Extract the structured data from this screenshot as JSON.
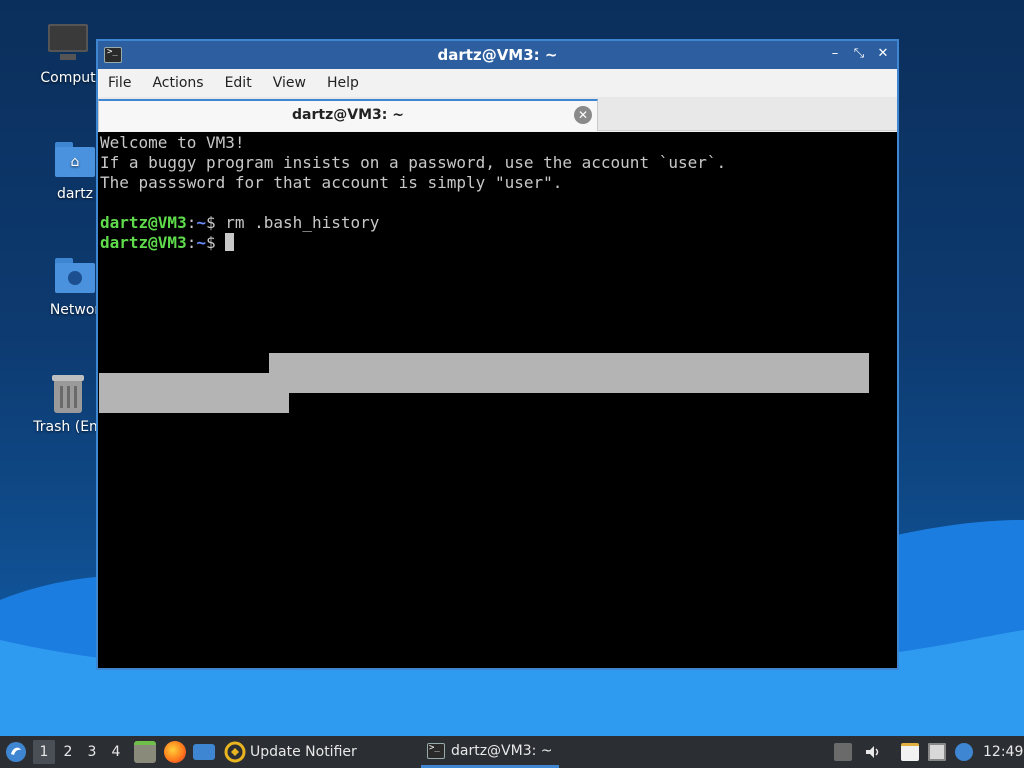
{
  "desktop": {
    "icons": [
      {
        "label": "Comput",
        "icon": "computer-icon"
      },
      {
        "label": "dartz",
        "icon": "home-folder-icon"
      },
      {
        "label": "Networ",
        "icon": "network-folder-icon"
      },
      {
        "label": "Trash (Em",
        "icon": "trash-icon"
      }
    ]
  },
  "window": {
    "title": "dartz@VM3: ~",
    "controls": {
      "minimize": "–",
      "maximize": "⤡",
      "close": "✕"
    },
    "menu": [
      "File",
      "Actions",
      "Edit",
      "View",
      "Help"
    ],
    "tab": {
      "label": "dartz@VM3: ~",
      "close": "✕"
    }
  },
  "terminal": {
    "lines": [
      "Welcome to VM3!",
      "If a buggy program insists on a password, use the account `user`.",
      "The passsword for that account is simply \"user\"."
    ],
    "prompt_user": "dartz@VM3",
    "prompt_sep": ":",
    "prompt_path": "~",
    "prompt_sym": "$ ",
    "command1": "rm .bash_history",
    "command2": ""
  },
  "taskbar": {
    "workspaces": [
      "1",
      "2",
      "3",
      "4"
    ],
    "active_workspace": "1",
    "apps": [
      {
        "label": "Update Notifier",
        "icon": "update-notifier-icon"
      },
      {
        "label": "dartz@VM3: ~",
        "icon": "terminal-icon"
      }
    ],
    "clock": "12:49"
  },
  "colors": {
    "accent": "#3f86d2",
    "prompt_user": "#5fdb4c",
    "prompt_path": "#6c8cff"
  }
}
